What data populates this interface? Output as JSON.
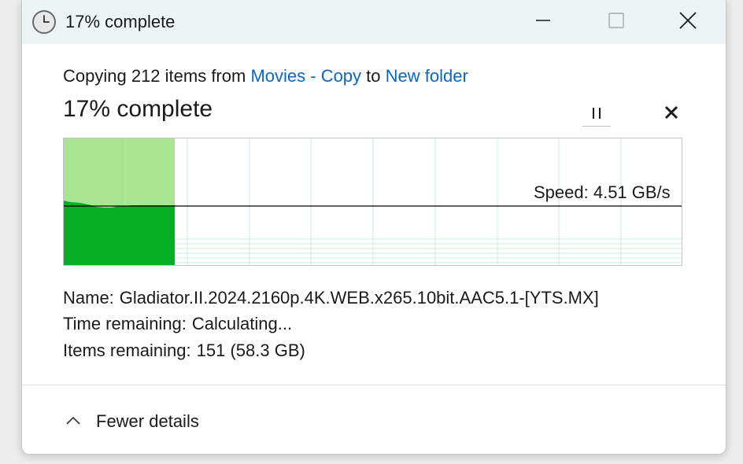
{
  "window": {
    "title": "17% complete",
    "icons": {
      "title": "clock-icon",
      "minimize": "minimize-icon",
      "maximize": "maximize-icon",
      "close": "close-icon"
    }
  },
  "copy": {
    "prefix": "Copying 212 items from",
    "source": "Movies - Copy",
    "connector": "to",
    "destination": "New folder",
    "heading": "17% complete",
    "progress_fraction": 0.17
  },
  "controls": {
    "pause_icon": "pause-icon",
    "cancel_icon": "close-icon"
  },
  "graph": {
    "speed_label": "Speed: 4.51 GB/s",
    "colors": {
      "done_light": "#a7e591",
      "done_dark": "#06ae24",
      "grid": "#d2ebd5",
      "border": "#c4c4c4",
      "speed_line": "#000000"
    }
  },
  "details": {
    "name_label": "Name:",
    "name_value": "Gladiator.II.2024.2160p.4K.WEB.x265.10bit.AAC5.1-[YTS.MX]",
    "time_label": "Time remaining:",
    "time_value": "Calculating...",
    "items_label": "Items remaining:",
    "items_value": "151 (58.3 GB)"
  },
  "footer": {
    "toggle_label": "Fewer details",
    "toggle_icon": "chevron-up-icon"
  }
}
